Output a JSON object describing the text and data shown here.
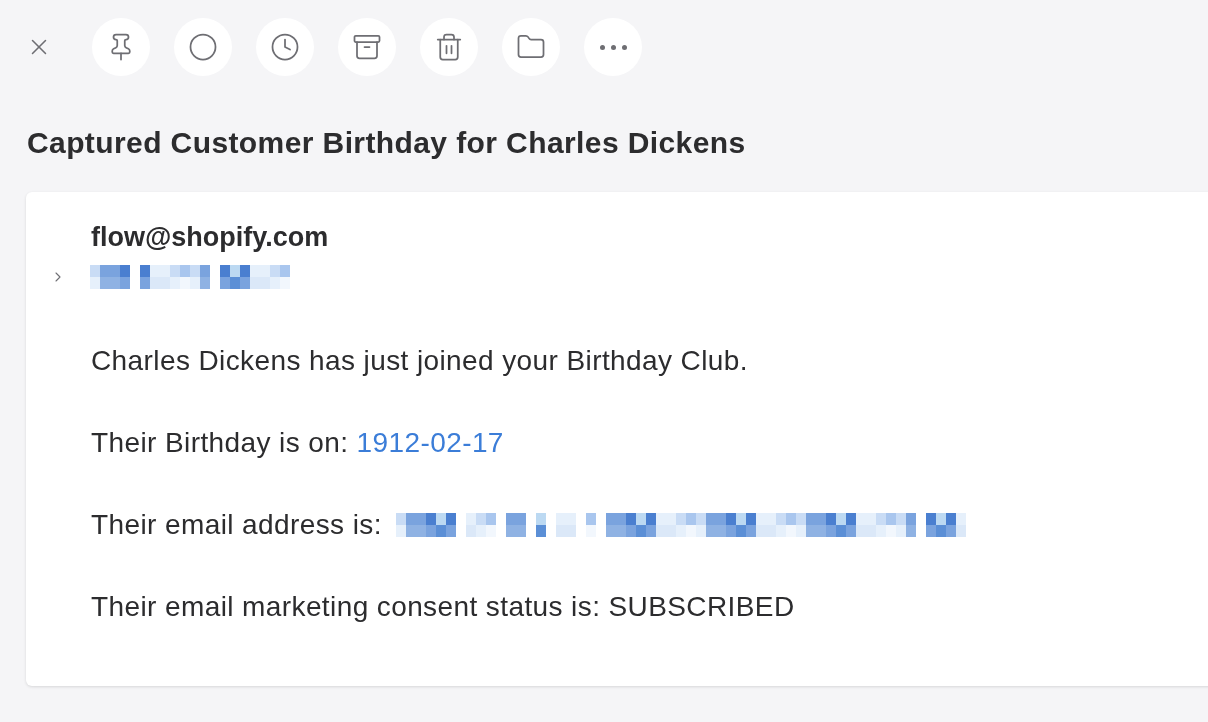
{
  "toolbar": {
    "buttons": [
      {
        "kind": "close"
      },
      {
        "kind": "pin"
      },
      {
        "kind": "circle"
      },
      {
        "kind": "clock"
      },
      {
        "kind": "archive"
      },
      {
        "kind": "trash"
      },
      {
        "kind": "folder"
      },
      {
        "kind": "more"
      }
    ]
  },
  "title": "Captured Customer Birthday for Charles Dickens",
  "message": {
    "sender": "flow@shopify.com",
    "recipients_expanded": false,
    "paragraphs": [
      {
        "kind": "text",
        "text": "Charles Dickens has just joined your Birthday Club."
      },
      {
        "kind": "link",
        "text": "Their Birthday is on:",
        "link": "1912-02-17"
      },
      {
        "kind": "redacted",
        "text": "Their email address is:"
      },
      {
        "kind": "text",
        "text": "Their email marketing consent status is: SUBSCRIBED"
      }
    ]
  }
}
